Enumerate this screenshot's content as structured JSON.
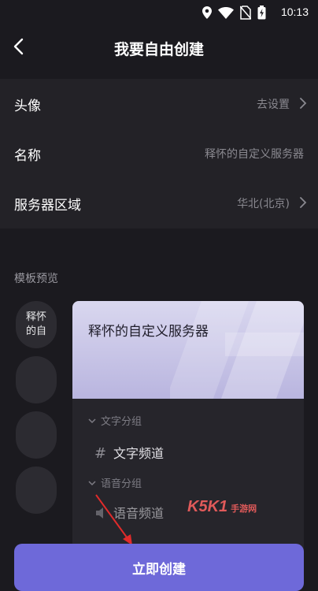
{
  "status_bar": {
    "time": "10:13",
    "icons": [
      "location-icon",
      "wifi-icon",
      "no-sim-icon",
      "battery-charging-icon"
    ]
  },
  "header": {
    "title": "我要自由创建",
    "back_icon": "back-arrow-icon"
  },
  "form": {
    "rows": [
      {
        "label": "头像",
        "value": "去设置",
        "chevron": true
      },
      {
        "label": "名称",
        "value": "释怀的自定义服务器",
        "chevron": false
      },
      {
        "label": "服务器区域",
        "value": "华北(北京)",
        "chevron": true
      }
    ]
  },
  "template_preview": {
    "title": "模板预览",
    "avatar_text": "释怀的自",
    "avatar_line1": "释怀",
    "avatar_line2": "的自",
    "card_title": "释怀的自定义服务器",
    "groups": [
      {
        "name": "文字分组",
        "channels": [
          "文字频道"
        ]
      },
      {
        "name": "语音分组",
        "channels": [
          "语音频道"
        ]
      }
    ]
  },
  "watermark": {
    "text": "K5K1",
    "subtext": "手游网"
  },
  "primary_button": {
    "label": "立即创建"
  },
  "colors": {
    "accent": "#6e69d9",
    "background": "#1b1a1f",
    "annotation": "#e02b2b"
  }
}
